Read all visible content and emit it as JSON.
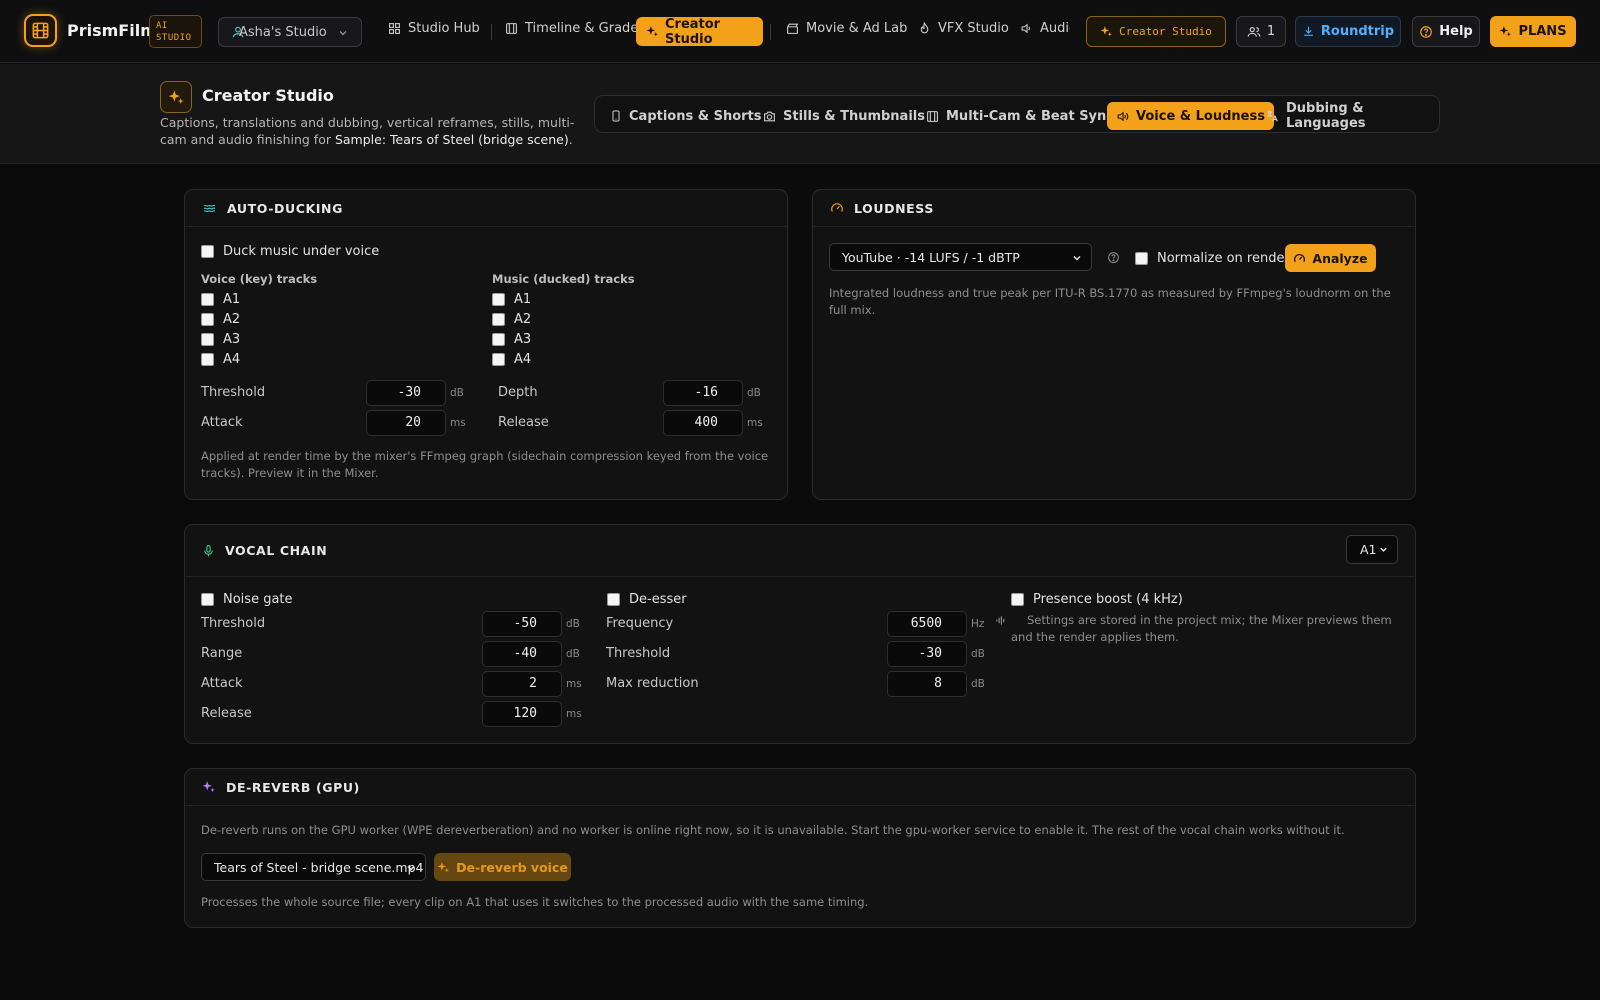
{
  "app": {
    "brand": "PrismFilm",
    "badge_line1": "AI",
    "badge_line2": "STUDIO",
    "studio_select": "Asha's Studio",
    "accent": "#f4a11a"
  },
  "nav": {
    "studio_hub": "Studio Hub",
    "timeline": "Timeline & Grade",
    "creator_studio": "Creator Studio",
    "movie_lab": "Movie & Ad Lab",
    "vfx_studio": "VFX Studio",
    "audio": "Audic"
  },
  "toolbar": {
    "creator_studio_tag": "Creator Studio",
    "users_count": "1",
    "roundtrip": "Roundtrip",
    "help": "Help",
    "plans": "PLANS"
  },
  "header": {
    "title": "Creator Studio",
    "desc_prefix": "Captions, translations and dubbing, vertical reframes, stills, multi-cam and audio finishing for ",
    "desc_project": "Sample: Tears of Steel (bridge scene)",
    "desc_suffix": "."
  },
  "tabs": [
    {
      "label": "Captions & Shorts",
      "icon": "phone-icon"
    },
    {
      "label": "Stills & Thumbnails",
      "icon": "camera-icon"
    },
    {
      "label": "Multi-Cam & Beat Sync",
      "icon": "film-icon"
    },
    {
      "label": "Voice & Loudness",
      "icon": "speaker-icon",
      "active": true
    },
    {
      "label": "Dubbing & Languages",
      "icon": "translate-icon"
    }
  ],
  "auto_ducking": {
    "title": "AUTO-DUCKING",
    "duck_label": "Duck music under voice",
    "voice_tracks_label": "Voice (key) tracks",
    "music_tracks_label": "Music (ducked) tracks",
    "voice_tracks": [
      "A1",
      "A2",
      "A3",
      "A4"
    ],
    "music_tracks": [
      "A1",
      "A2",
      "A3",
      "A4"
    ],
    "threshold_label": "Threshold",
    "threshold_value": "-30",
    "threshold_unit": "dB",
    "attack_label": "Attack",
    "attack_value": "20",
    "attack_unit": "ms",
    "depth_label": "Depth",
    "depth_value": "-16",
    "depth_unit": "dB",
    "release_label": "Release",
    "release_value": "400",
    "release_unit": "ms",
    "note": "Applied at render time by the mixer's FFmpeg graph (sidechain compression keyed from the voice tracks). Preview it in the Mixer."
  },
  "loudness": {
    "title": "LOUDNESS",
    "preset": "YouTube · -14 LUFS / -1 dBTP",
    "normalize_label": "Normalize on render",
    "analyze_label": "Analyze",
    "note": "Integrated loudness and true peak per ITU-R BS.1770 as measured by FFmpeg's loudnorm on the full mix."
  },
  "vocal_chain": {
    "title": "VOCAL CHAIN",
    "track": "A1",
    "noise_gate_label": "Noise gate",
    "ng_threshold_label": "Threshold",
    "ng_threshold_value": "-50",
    "ng_threshold_unit": "dB",
    "ng_range_label": "Range",
    "ng_range_value": "-40",
    "ng_range_unit": "dB",
    "ng_attack_label": "Attack",
    "ng_attack_value": "2",
    "ng_attack_unit": "ms",
    "ng_release_label": "Release",
    "ng_release_value": "120",
    "ng_release_unit": "ms",
    "deesser_label": "De-esser",
    "de_freq_label": "Frequency",
    "de_freq_value": "6500",
    "de_freq_unit": "Hz",
    "de_threshold_label": "Threshold",
    "de_threshold_value": "-30",
    "de_threshold_unit": "dB",
    "de_maxred_label": "Max reduction",
    "de_maxred_value": "8",
    "de_maxred_unit": "dB",
    "presence_label": "Presence boost (4 kHz)",
    "presence_note": "Settings are stored in the project mix; the Mixer previews them and the render applies them."
  },
  "dereverb": {
    "title": "DE-REVERB (GPU)",
    "warning": "De-reverb runs on the GPU worker (WPE dereverberation) and no worker is online right now, so it is unavailable. Start the gpu-worker service to enable it. The rest of the vocal chain works without it.",
    "source_file": "Tears of Steel - bridge scene.mp4",
    "button_label": "De-reverb voice",
    "note": "Processes the whole source file; every clip on A1 that uses it switches to the processed audio with the same timing."
  }
}
